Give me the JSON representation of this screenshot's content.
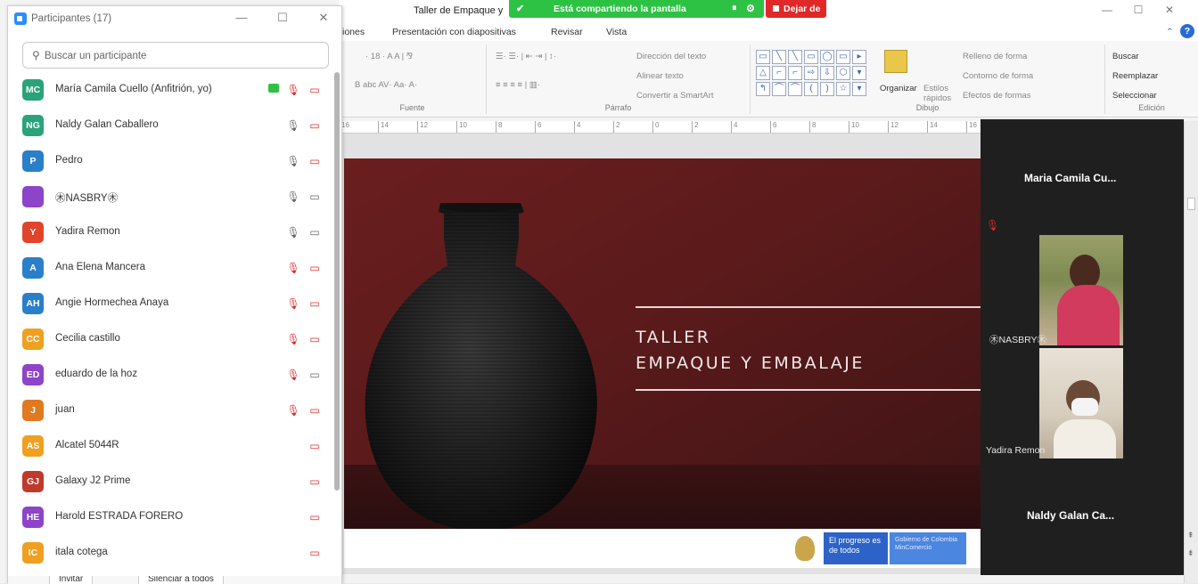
{
  "ppt": {
    "title": "Taller de Empaque y",
    "tabs": [
      "iones",
      "Presentación con diapositivas",
      "Revisar",
      "Vista"
    ],
    "ribbon": {
      "fuente_label": "Fuente",
      "parrafo_label": "Párrafo",
      "dibujo_label": "Dibujo",
      "edicion_label": "Edición",
      "direccion_texto": "Dirección del texto",
      "alinear_texto": "Alinear texto",
      "convertir_smartart": "Convertir a SmartArt",
      "organizar": "Organizar",
      "estilos_rapidos": "Estilos rápidos",
      "relleno_forma": "Relleno de forma",
      "contorno_forma": "Contorno de forma",
      "efectos_forma": "Efectos de formas",
      "buscar": "Buscar",
      "reemplazar": "Reemplazar",
      "seleccionar": "Seleccionar"
    },
    "slide": {
      "line1": "TALLER",
      "line2": "EMPAQUE Y EMBALAJE",
      "footer_box1": "El progreso es de todos",
      "footer_box2": "Gobierno de Colombia MinComercio"
    }
  },
  "share_banner": {
    "text": "Está compartiendo la pantalla",
    "stop_label": "Dejar de"
  },
  "participants": {
    "title": "Participantes (17)",
    "search_placeholder": "Buscar un participante",
    "list": [
      {
        "initials": "MC",
        "name": "María Camila Cuello (Anfitrión, yo)",
        "color": "#2aa37a",
        "mic": "muted",
        "video": "off",
        "sharing": true
      },
      {
        "initials": "NG",
        "name": "Naldy Galan Caballero",
        "color": "#2aa37a",
        "mic": "on",
        "video": "off",
        "sharing": false
      },
      {
        "initials": "P",
        "name": "Pedro",
        "color": "#2a7fc9",
        "mic": "on",
        "video": "off",
        "sharing": false
      },
      {
        "initials": "",
        "name": "㊍NASBRY㊍",
        "color": "#8e44c9",
        "mic": "active",
        "video": "on",
        "sharing": false
      },
      {
        "initials": "Y",
        "name": "Yadira Remon",
        "color": "#e0452b",
        "mic": "on",
        "video": "on",
        "sharing": false
      },
      {
        "initials": "A",
        "name": "Ana Elena Mancera",
        "color": "#2a7fc9",
        "mic": "muted",
        "video": "off",
        "sharing": false
      },
      {
        "initials": "AH",
        "name": "Angie Hormechea Anaya",
        "color": "#2a7fc9",
        "mic": "muted",
        "video": "off",
        "sharing": false
      },
      {
        "initials": "CC",
        "name": "Cecilia castillo",
        "color": "#f0a020",
        "mic": "muted",
        "video": "off",
        "sharing": false
      },
      {
        "initials": "ED",
        "name": "eduardo de la hoz",
        "color": "#8e44c9",
        "mic": "muted",
        "video": "on",
        "sharing": false
      },
      {
        "initials": "J",
        "name": "juan",
        "color": "#e07a20",
        "mic": "muted",
        "video": "off",
        "sharing": false
      },
      {
        "initials": "AS",
        "name": "Alcatel 5044R",
        "color": "#f0a020",
        "mic": "none",
        "video": "off",
        "sharing": false
      },
      {
        "initials": "GJ",
        "name": "Galaxy J2 Prime",
        "color": "#c0392b",
        "mic": "none",
        "video": "off",
        "sharing": false
      },
      {
        "initials": "HE",
        "name": "Harold ESTRADA FORERO",
        "color": "#8e44c9",
        "mic": "none",
        "video": "off",
        "sharing": false
      },
      {
        "initials": "IC",
        "name": "itala cotega",
        "color": "#f0a020",
        "mic": "none",
        "video": "off",
        "sharing": false
      }
    ],
    "bottom_buttons": [
      "Invitar",
      "Silenciar a todos"
    ]
  },
  "gallery": {
    "tile1_name": "Maria Camila Cu...",
    "tile2_label": "㊍NASBRY㊍",
    "tile3_label": "Yadira Remon",
    "tile4_name": "Naldy Galan Ca..."
  },
  "colors": {
    "share_green": "#2ec244",
    "stop_red": "#e02828",
    "slide_bg": "#5b1a1b"
  }
}
